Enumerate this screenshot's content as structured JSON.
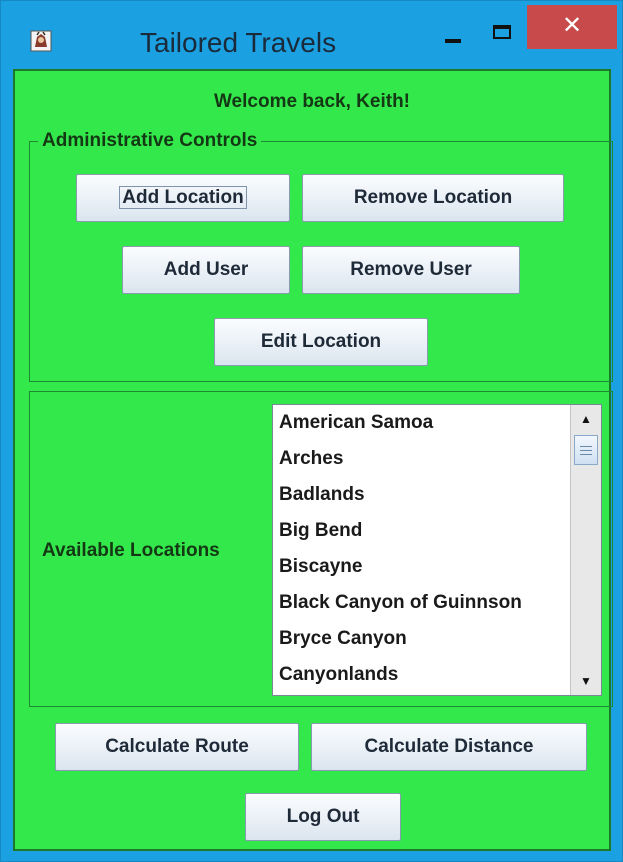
{
  "window": {
    "title": "Tailored Travels",
    "close_glyph": "✕",
    "colors": {
      "title_bar": "#1ba1e2",
      "client_bg": "#33e84b",
      "close_button": "#c84a4a"
    }
  },
  "welcome": {
    "text": "Welcome back, Keith!"
  },
  "admin": {
    "legend": "Administrative Controls",
    "add_location": "Add Location",
    "remove_location": "Remove Location",
    "add_user": "Add User",
    "remove_user": "Remove User",
    "edit_location": "Edit Location"
  },
  "locations": {
    "label": "Available Locations",
    "items": [
      "American Samoa",
      "Arches",
      "Badlands",
      "Big Bend",
      "Biscayne",
      "Black Canyon of Guinnson",
      "Bryce Canyon",
      "Canyonlands"
    ]
  },
  "actions": {
    "calculate_route": "Calculate Route",
    "calculate_distance": "Calculate Distance",
    "log_out": "Log Out"
  }
}
